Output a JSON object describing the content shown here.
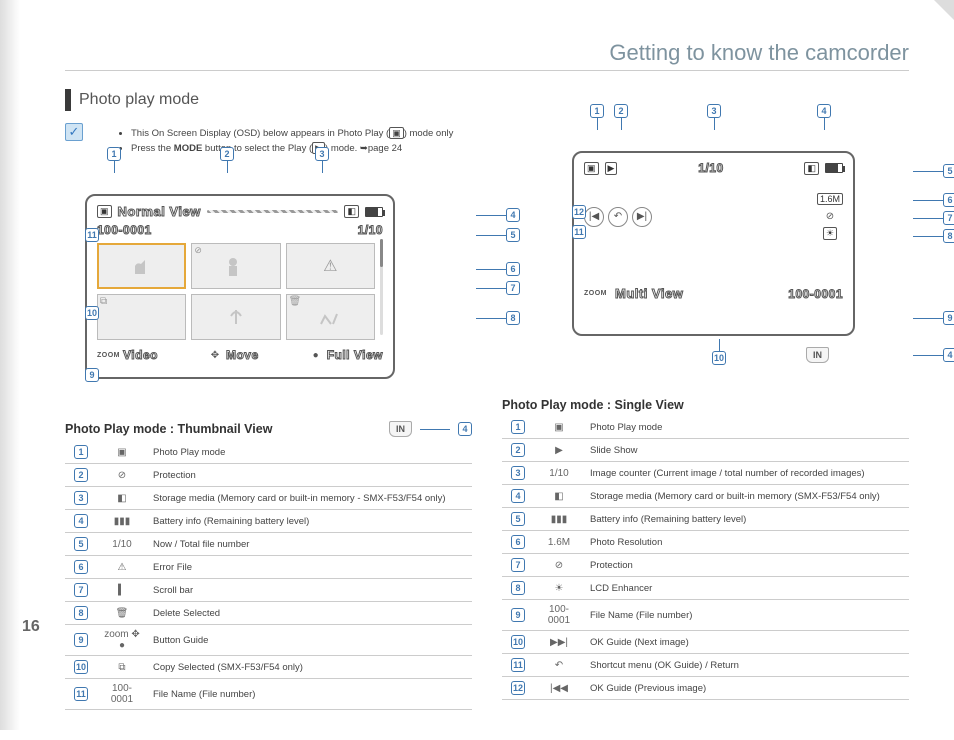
{
  "page": {
    "number": "16",
    "chapter": "Getting to know the camcorder"
  },
  "section": {
    "title": "Photo play mode"
  },
  "notes": {
    "n1": "This On Screen Display (OSD) below appears in Photo Play (",
    "n1b": ") mode only",
    "n2a": "Press the ",
    "n2b": "MODE",
    "n2c": " button to select the Play (",
    "n2d": ") mode.  ➥page 24"
  },
  "screen1": {
    "title": "Normal View",
    "file": "100-0001",
    "counter": "1/10",
    "guide": {
      "zoom": "ZOOM",
      "a": "Video",
      "b": "Move",
      "c": "Full View"
    }
  },
  "screen2": {
    "counter": "1/10",
    "multi": "Multi View",
    "file": "100-0001",
    "zoom": "ZOOM"
  },
  "thumbView": {
    "title": "Photo Play mode : Thumbnail View",
    "storage": "IN",
    "rows": [
      {
        "n": "1",
        "ic": "photo-play-icon",
        "g": "▣",
        "d": "Photo Play mode"
      },
      {
        "n": "2",
        "ic": "protection-icon",
        "g": "⊘",
        "d": "Protection"
      },
      {
        "n": "3",
        "ic": "storage-icon",
        "g": "◧",
        "d": "Storage media (Memory card or built-in memory - SMX-F53/F54 only)"
      },
      {
        "n": "4",
        "ic": "battery-icon",
        "g": "▮▮▮",
        "d": "Battery info (Remaining battery level)"
      },
      {
        "n": "5",
        "ic": "counter-icon",
        "g": "1/10",
        "d": "Now / Total file number"
      },
      {
        "n": "6",
        "ic": "error-icon",
        "g": "⚠",
        "d": "Error File"
      },
      {
        "n": "7",
        "ic": "scrollbar-icon",
        "g": "▍",
        "d": "Scroll bar"
      },
      {
        "n": "8",
        "ic": "delete-icon",
        "g": "🗑",
        "d": "Delete Selected"
      },
      {
        "n": "9",
        "ic": "button-guide-icon",
        "g": "zoom ✥ ●",
        "d": "Button Guide"
      },
      {
        "n": "10",
        "ic": "copy-icon",
        "g": "⧉",
        "d": "Copy Selected (SMX-F53/F54 only)"
      },
      {
        "n": "11",
        "ic": "filename-icon",
        "g": "100-0001",
        "d": "File Name (File number)"
      }
    ]
  },
  "singleView": {
    "title": "Photo Play mode : Single View",
    "storage": "IN",
    "rows": [
      {
        "n": "1",
        "ic": "photo-play-icon",
        "g": "▣",
        "d": "Photo Play mode"
      },
      {
        "n": "2",
        "ic": "slideshow-icon",
        "g": "▶",
        "d": "Slide Show"
      },
      {
        "n": "3",
        "ic": "counter-icon",
        "g": "1/10",
        "d": "Image counter (Current image / total number of recorded images)"
      },
      {
        "n": "4",
        "ic": "storage-icon",
        "g": "◧",
        "d": "Storage media (Memory card or built-in memory (SMX-F53/F54 only)"
      },
      {
        "n": "5",
        "ic": "battery-icon",
        "g": "▮▮▮",
        "d": "Battery info (Remaining battery level)"
      },
      {
        "n": "6",
        "ic": "resolution-icon",
        "g": "1.6M",
        "d": "Photo Resolution"
      },
      {
        "n": "7",
        "ic": "protection-icon",
        "g": "⊘",
        "d": "Protection"
      },
      {
        "n": "8",
        "ic": "lcd-enhancer-icon",
        "g": "☀",
        "d": "LCD Enhancer"
      },
      {
        "n": "9",
        "ic": "filename-icon",
        "g": "100-0001",
        "d": "File Name (File number)"
      },
      {
        "n": "10",
        "ic": "next-icon",
        "g": "▶▶|",
        "d": "OK Guide (Next image)"
      },
      {
        "n": "11",
        "ic": "return-icon",
        "g": "↶",
        "d": "Shortcut menu (OK Guide) / Return"
      },
      {
        "n": "12",
        "ic": "prev-icon",
        "g": "|◀◀",
        "d": "OK Guide (Previous image)"
      }
    ]
  }
}
